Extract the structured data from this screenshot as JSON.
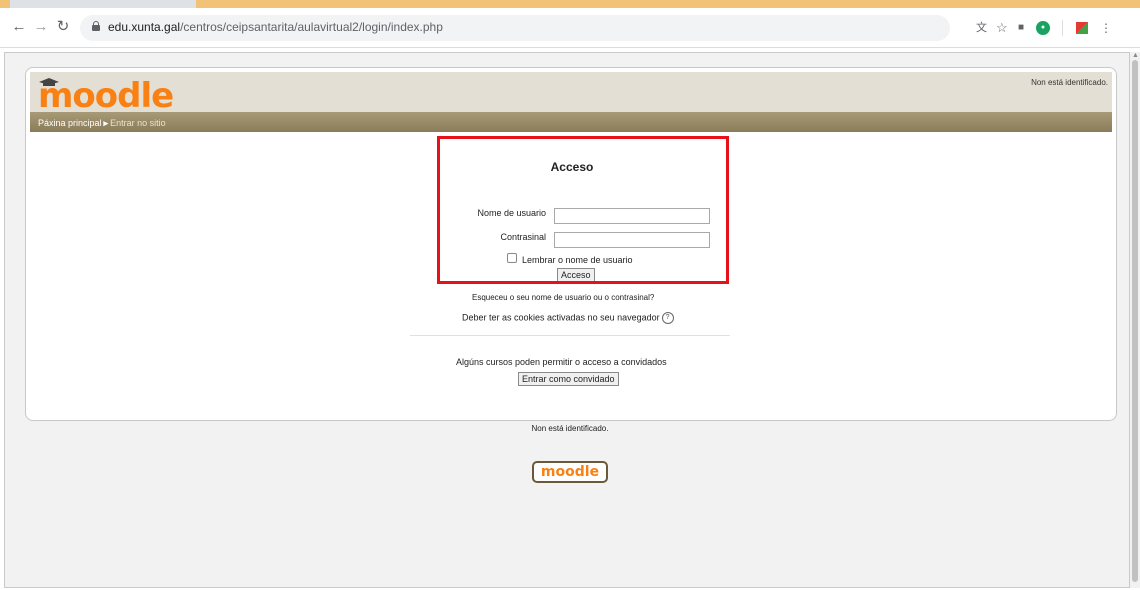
{
  "browser": {
    "url_host": "edu.xunta.gal",
    "url_path": "/centros/ceipsantarita/aulavirtual2/login/index.php"
  },
  "header": {
    "logo_text": "moodle",
    "login_info": "Non está identificado.",
    "breadcrumb": {
      "home": "Páxina principal",
      "current": "Entrar no sitio"
    }
  },
  "login": {
    "title": "Acceso",
    "username_label": "Nome de usuario",
    "username_value": "",
    "password_label": "Contrasinal",
    "password_value": "",
    "remember_label": "Lembrar o nome de usuario",
    "submit_label": "Acceso",
    "forgot_link": "Esqueceu o seu nome de usuario ou o contrasinal?",
    "cookies_notice": "Deber ter as cookies activadas no seu navegador"
  },
  "guest": {
    "notice": "Algúns cursos poden permitir o acceso a convidados",
    "button_label": "Entrar como convidado"
  },
  "footer": {
    "login_info": "Non está identificado.",
    "logo_text": "moodle"
  },
  "colors": {
    "moodle_orange": "#f98012",
    "header_bg": "#e4dfd4",
    "navbar": "#998a66",
    "highlight": "#e5121b"
  }
}
